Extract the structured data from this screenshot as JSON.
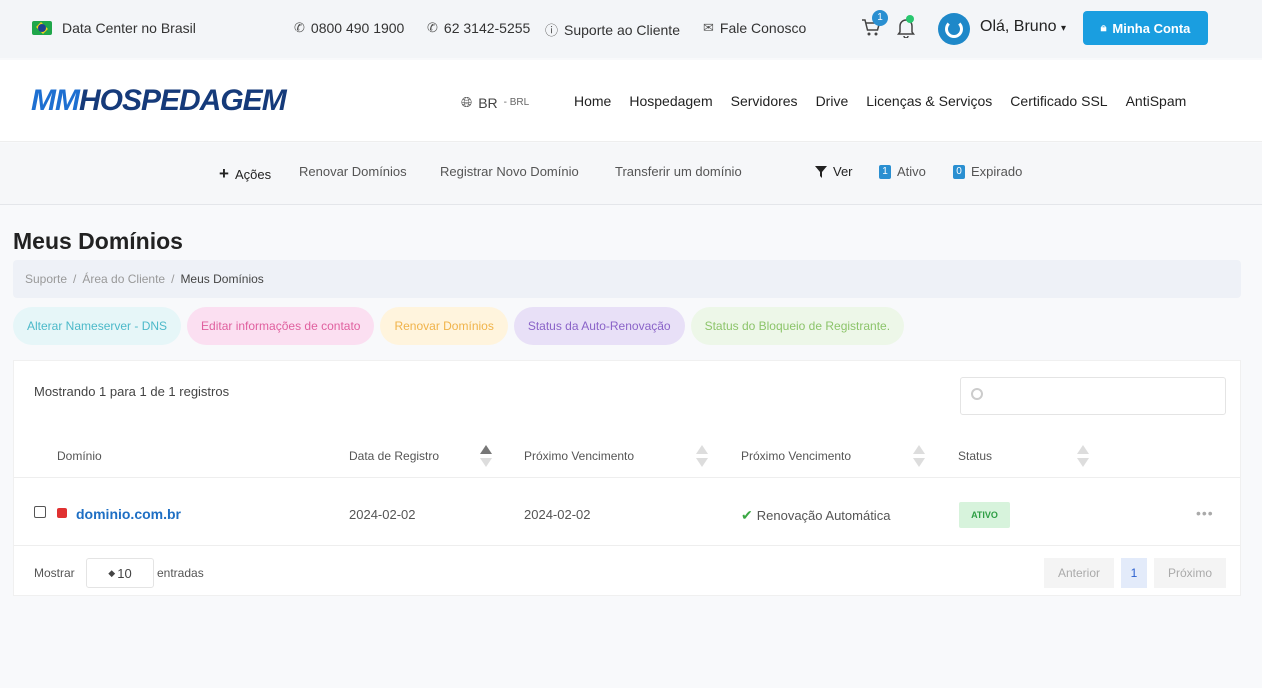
{
  "topbar": {
    "datacenter": "Data Center no Brasil",
    "phone1": "0800 490 1900",
    "phone2": "62 3142-5255",
    "support": "Suporte ao Cliente",
    "contact": "Fale Conosco",
    "cart_count": "1",
    "greeting": "Olá, Bruno",
    "account_button": "Minha Conta"
  },
  "nav": {
    "logo_part1": "MM",
    "logo_part2": "HOSPEDAGEM",
    "currency_main": "BR",
    "currency_sub": "- BRL",
    "items": [
      "Home",
      "Hospedagem",
      "Servidores",
      "Drive",
      "Licenças & Serviços",
      "Certificado SSL",
      "AntiSpam"
    ]
  },
  "subnav": {
    "actions": "Ações",
    "renew": "Renovar Domínios",
    "register": "Registrar Novo Domínio",
    "transfer": "Transferir um domínio",
    "view": "Ver",
    "active_count": "1",
    "active_label": "Ativo",
    "expired_count": "0",
    "expired_label": "Expirado"
  },
  "page": {
    "title": "Meus Domínios",
    "breadcrumb": [
      "Suporte",
      "Área do Cliente",
      "Meus Domínios"
    ]
  },
  "pills": [
    {
      "label": "Alterar Nameserver - DNS",
      "bg": "#e6f6f8",
      "fg": "#4cb9c9"
    },
    {
      "label": "Editar informações de contato",
      "bg": "#fbdff1",
      "fg": "#e0609f"
    },
    {
      "label": "Renovar Domínios",
      "bg": "#fff4dd",
      "fg": "#f0b34a"
    },
    {
      "label": "Status da Auto-Renovação",
      "bg": "#e8e0f7",
      "fg": "#8a63c8"
    },
    {
      "label": "Status do Bloqueio de Registrante.",
      "bg": "#edf7e8",
      "fg": "#8cc46a"
    }
  ],
  "table": {
    "showing": "Mostrando 1 para 1 de 1 registros",
    "columns": [
      "Domínio",
      "Data de Registro",
      "Próximo Vencimento",
      "Próximo Vencimento",
      "Status"
    ],
    "row": {
      "domain": "dominio.com.br",
      "reg_date": "2024-02-02",
      "next_due": "2024-02-02",
      "renewal": "Renovação Automática",
      "status": "ATIVO"
    },
    "show_label": "Mostrar",
    "entries_value": "10",
    "entries_label": "entradas",
    "prev": "Anterior",
    "page": "1",
    "next": "Próximo"
  }
}
